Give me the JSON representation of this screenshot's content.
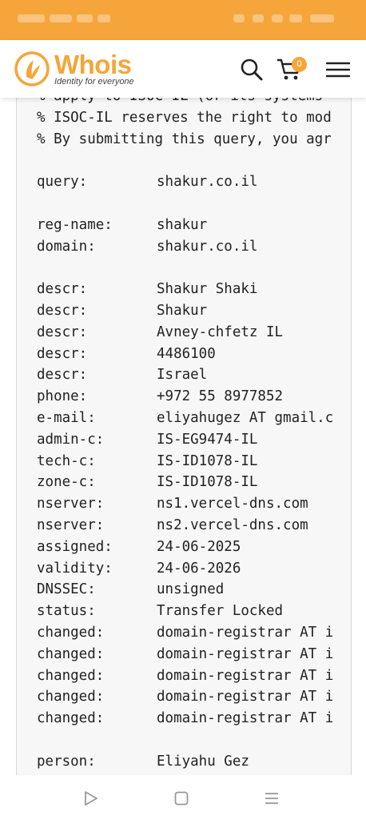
{
  "header": {
    "logo_word_1": "Who",
    "logo_word_2": "is",
    "logo_tagline": "Identity for everyone",
    "search_icon": "search-icon",
    "cart_icon": "cart-icon",
    "cart_count": "0",
    "menu_icon": "hamburger-menu-icon"
  },
  "colors": {
    "brand": "#f5a53a",
    "text": "#222222",
    "panel": "#f7f7f7"
  },
  "whois": {
    "notices": [
      "% apply to ISOC-IL (or its systems",
      "% ISOC-IL reserves the right to mod",
      "% By submitting this query, you agr"
    ],
    "query": [
      {
        "label": "query:",
        "value": "shakur.co.il"
      }
    ],
    "domain": [
      {
        "label": "reg-name:",
        "value": "shakur"
      },
      {
        "label": "domain:",
        "value": "shakur.co.il"
      }
    ],
    "details": [
      {
        "label": "descr:",
        "value": "Shakur Shaki"
      },
      {
        "label": "descr:",
        "value": "Shakur"
      },
      {
        "label": "descr:",
        "value": "Avney-chfetz IL"
      },
      {
        "label": "descr:",
        "value": "4486100"
      },
      {
        "label": "descr:",
        "value": "Israel"
      },
      {
        "label": "phone:",
        "value": "+972 55 8977852"
      },
      {
        "label": "e-mail:",
        "value": "eliyahugez AT gmail.c"
      },
      {
        "label": "admin-c:",
        "value": "IS-EG9474-IL"
      },
      {
        "label": "tech-c:",
        "value": "IS-ID1078-IL"
      },
      {
        "label": "zone-c:",
        "value": "IS-ID1078-IL"
      },
      {
        "label": "nserver:",
        "value": "ns1.vercel-dns.com"
      },
      {
        "label": "nserver:",
        "value": "ns2.vercel-dns.com"
      },
      {
        "label": "assigned:",
        "value": "24-06-2025"
      },
      {
        "label": "validity:",
        "value": "24-06-2026"
      },
      {
        "label": "DNSSEC:",
        "value": "unsigned"
      },
      {
        "label": "status:",
        "value": "Transfer Locked"
      },
      {
        "label": "changed:",
        "value": "domain-registrar AT i"
      },
      {
        "label": "changed:",
        "value": "domain-registrar AT i"
      },
      {
        "label": "changed:",
        "value": "domain-registrar AT i"
      },
      {
        "label": "changed:",
        "value": "domain-registrar AT i"
      },
      {
        "label": "changed:",
        "value": "domain-registrar AT i"
      }
    ],
    "person": [
      {
        "label": "person:",
        "value": "Eliyahu Gez"
      }
    ]
  },
  "nav": {
    "back_icon": "back-triangle-icon",
    "home_icon": "home-square-icon",
    "recents_icon": "recents-lines-icon"
  }
}
